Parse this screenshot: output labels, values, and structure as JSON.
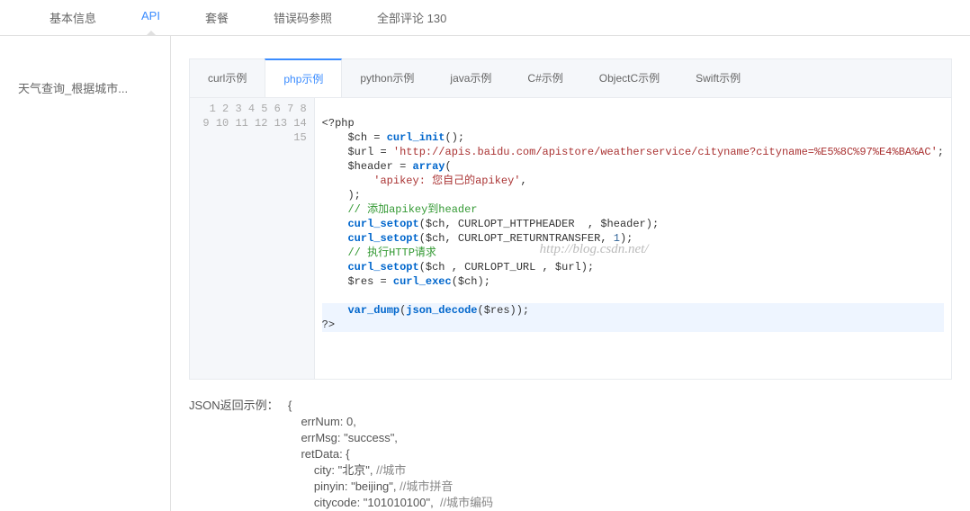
{
  "top_tabs": {
    "basic": "基本信息",
    "api": "API",
    "package": "套餐",
    "errcode": "错误码参照",
    "comments": "全部评论 130"
  },
  "sidebar": {
    "item1": "天气查询_根据城市..."
  },
  "lang_tabs": {
    "curl": "curl示例",
    "php": "php示例",
    "python": "python示例",
    "java": "java示例",
    "csharp": "C#示例",
    "objectc": "ObjectC示例",
    "swift": "Swift示例"
  },
  "code": {
    "l1": "<?php",
    "l2a": "    $ch = ",
    "l2b": "curl_init",
    "l2c": "();",
    "l3a": "    $url = ",
    "l3b": "'http://apis.baidu.com/apistore/weatherservice/cityname?cityname=%E5%8C%97%E4%BA%AC'",
    "l3c": ";",
    "l4a": "    $header = ",
    "l4b": "array",
    "l4c": "(",
    "l5a": "        ",
    "l5b": "'apikey: 您自己的apikey'",
    "l5c": ",",
    "l6": "    );",
    "l7a": "    ",
    "l7b": "// 添加apikey到header",
    "l8a": "    ",
    "l8b": "curl_setopt",
    "l8c": "($ch, CURLOPT_HTTPHEADER  , $header);",
    "l9a": "    ",
    "l9b": "curl_setopt",
    "l9c": "($ch, CURLOPT_RETURNTRANSFER, ",
    "l9d": "1",
    "l9e": ");",
    "l10a": "    ",
    "l10b": "// 执行HTTP请求",
    "l11a": "    ",
    "l11b": "curl_setopt",
    "l11c": "($ch , CURLOPT_URL , $url);",
    "l12a": "    $res = ",
    "l12b": "curl_exec",
    "l12c": "($ch);",
    "l13": "",
    "l14a": "    ",
    "l14b": "var_dump",
    "l14c": "(",
    "l14d": "json_decode",
    "l14e": "($res));",
    "l15": "?>"
  },
  "line_numbers": [
    "1",
    "2",
    "3",
    "4",
    "5",
    "6",
    "7",
    "8",
    "9",
    "10",
    "11",
    "12",
    "13",
    "14",
    "15"
  ],
  "watermark": "http://blog.csdn.net/",
  "json_example": {
    "label": "JSON返回示例：",
    "line1": "{",
    "line2": "    errNum: 0,",
    "line3": "    errMsg: \"success\",",
    "line4": "    retData: {",
    "line5a": "        city: \"北京\", ",
    "line5b": "//城市",
    "line6a": "        pinyin: \"beijing\", ",
    "line6b": "//城市拼音",
    "line7a": "        citycode: \"101010100\",  ",
    "line7b": "//城市编码"
  }
}
